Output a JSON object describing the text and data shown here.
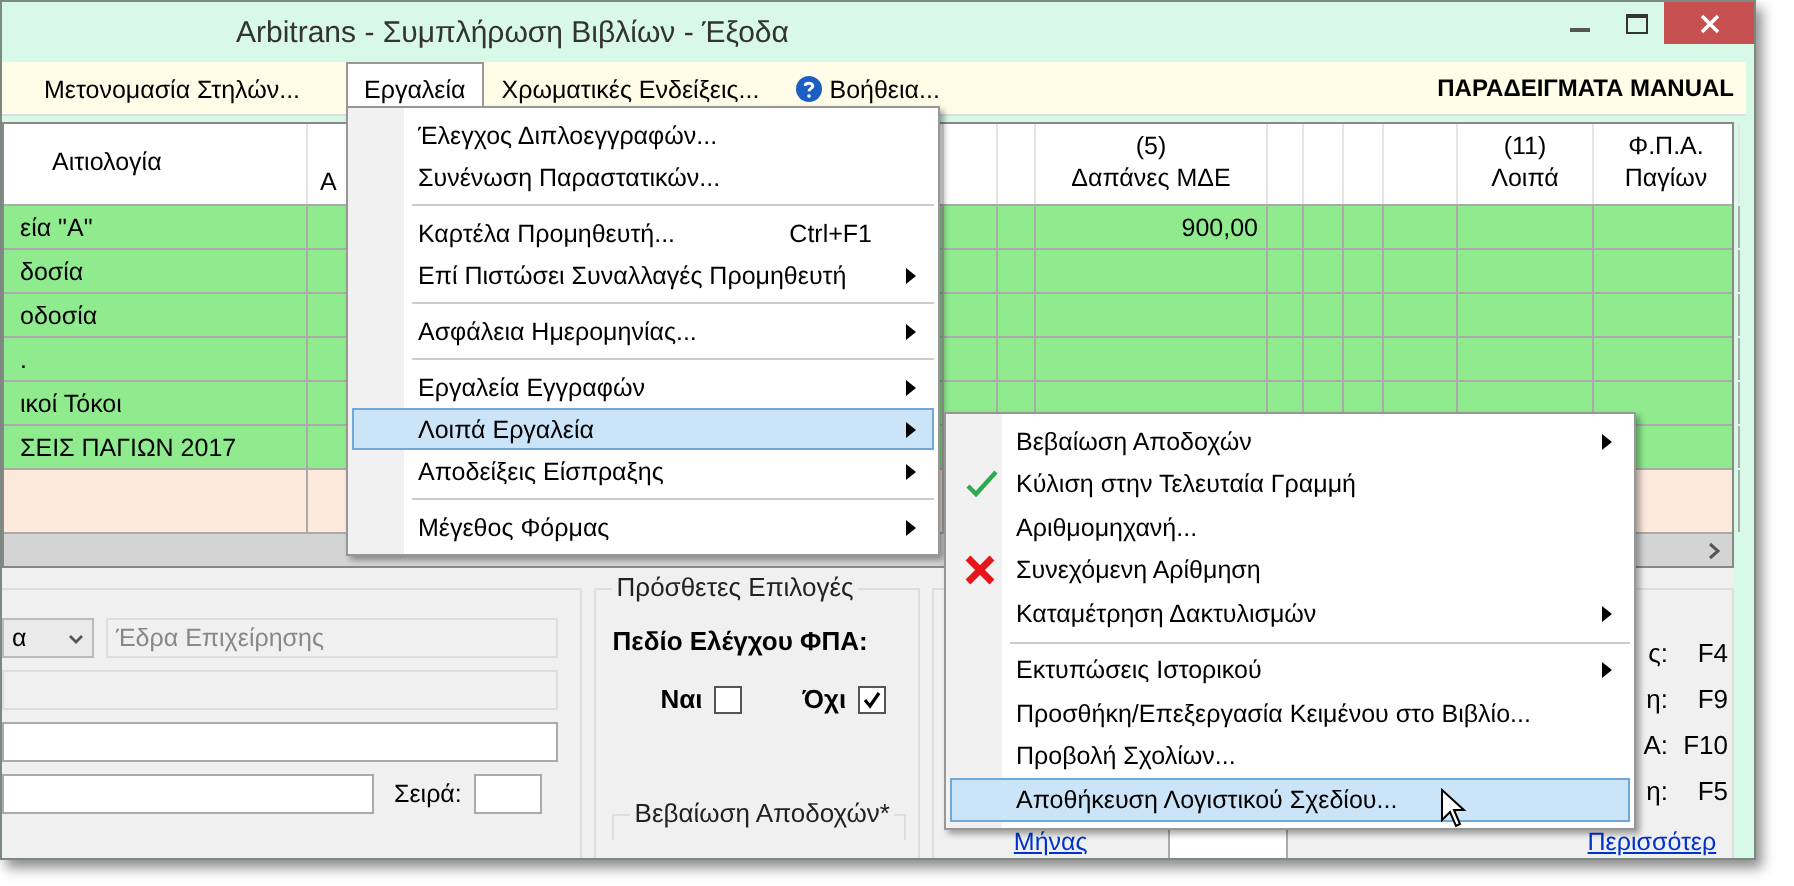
{
  "window": {
    "title": "Arbitrans - Συμπλήρωση Βιβλίων - Έξοδα"
  },
  "menu_bar": {
    "items": [
      {
        "label": "Μετονομασία Στηλών...",
        "kind": "plain",
        "selected": false
      },
      {
        "label": "Εργαλεία",
        "kind": "plain",
        "selected": true
      },
      {
        "label": "Χρωματικές Ενδείξεις...",
        "kind": "plain",
        "selected": false
      },
      {
        "label": "Βοήθεια...",
        "kind": "help",
        "selected": false
      }
    ],
    "company": "ΠΑΡΑΔΕΙΓΜΑΤΑ MANUAL"
  },
  "grid": {
    "headers": [
      {
        "lines": [
          "Αιτιολογία"
        ]
      },
      {
        "lines": [
          "Α"
        ]
      },
      {
        "lines": [
          "(5)",
          "Δαπάνες ΜΔΕ"
        ]
      },
      {
        "lines": [
          "(11)",
          "Λοιπά"
        ]
      },
      {
        "lines": [
          "Φ.Π.Α.",
          "Παγίων"
        ]
      }
    ],
    "rows": [
      {
        "kind": "entry",
        "description": "εία \"Α\"",
        "mde": "900,00"
      },
      {
        "kind": "entry",
        "description": "δοσία"
      },
      {
        "kind": "entry",
        "description": "οδοσία"
      },
      {
        "kind": "entry",
        "description": "."
      },
      {
        "kind": "entry",
        "description": "ικοί Τόκοι"
      },
      {
        "kind": "entry",
        "description": "ΣΕΙΣ ΠΑΓΙΩΝ 2017"
      },
      {
        "kind": "new"
      }
    ]
  },
  "details": {
    "branch_combo": "α",
    "branch_field": "Έδρα Επιχείρησης",
    "series_label": "Σειρά:"
  },
  "extra_options": {
    "title": "Πρόσθετες Επιλογές",
    "vat_check_label": "Πεδίο Ελέγχου ΦΠΑ:",
    "options": [
      {
        "label": "Ναι",
        "checked": false
      },
      {
        "label": "Όχι",
        "checked": true
      }
    ],
    "subgroup_title": "Βεβαίωση Αποδοχών*"
  },
  "shortcuts": [
    {
      "label": "ς:",
      "key": "F4"
    },
    {
      "label": "η:",
      "key": "F9"
    },
    {
      "label": "Α:",
      "key": "F10"
    },
    {
      "label": "η:",
      "key": "F5"
    }
  ],
  "links": {
    "month": "Μήνας",
    "more": "Περισσότερ"
  },
  "tools_menu": {
    "items": [
      {
        "kind": "item",
        "label": "Έλεγχος Διπλοεγγραφών...",
        "submenu": false,
        "selected": false
      },
      {
        "kind": "item",
        "label": "Συνένωση Παραστατικών...",
        "submenu": false,
        "selected": false
      },
      {
        "kind": "separator"
      },
      {
        "kind": "item",
        "label": "Καρτέλα Προμηθευτή...",
        "shortcut": "Ctrl+F1",
        "submenu": false,
        "selected": false
      },
      {
        "kind": "item",
        "label": "Επί Πιστώσει Συναλλαγές Προμηθευτή",
        "submenu": true,
        "selected": false
      },
      {
        "kind": "separator"
      },
      {
        "kind": "item",
        "label": "Ασφάλεια Ημερομηνίας...",
        "submenu": true,
        "selected": false
      },
      {
        "kind": "separator"
      },
      {
        "kind": "item",
        "label": "Εργαλεία Εγγραφών",
        "submenu": true,
        "selected": false
      },
      {
        "kind": "item",
        "label": "Λοιπά Εργαλεία",
        "submenu": true,
        "selected": true
      },
      {
        "kind": "item",
        "label": "Αποδείξεις Είσπραξης",
        "submenu": true,
        "selected": false
      },
      {
        "kind": "separator"
      },
      {
        "kind": "item",
        "label": "Μέγεθος Φόρμας",
        "submenu": true,
        "selected": false
      }
    ]
  },
  "other_tools_menu": {
    "items": [
      {
        "kind": "item",
        "label": "Βεβαίωση Αποδοχών",
        "checked": false,
        "off": false,
        "submenu": true,
        "selected": false
      },
      {
        "kind": "item",
        "label": "Κύλιση στην Τελευταία Γραμμή",
        "checked": true,
        "off": false,
        "submenu": false,
        "selected": false
      },
      {
        "kind": "item",
        "label": "Αριθμομηχανή...",
        "checked": false,
        "off": false,
        "submenu": false,
        "selected": false
      },
      {
        "kind": "item",
        "label": "Συνεχόμενη Αρίθμηση",
        "checked": false,
        "off": true,
        "submenu": false,
        "selected": false
      },
      {
        "kind": "item",
        "label": "Καταμέτρηση Δακτυλισμών",
        "checked": false,
        "off": false,
        "submenu": true,
        "selected": false
      },
      {
        "kind": "separator"
      },
      {
        "kind": "item",
        "label": "Εκτυπώσεις Ιστορικού",
        "checked": false,
        "off": false,
        "submenu": true,
        "selected": false
      },
      {
        "kind": "item",
        "label": "Προσθήκη/Επεξεργασία Κειμένου στο Βιβλίο...",
        "checked": false,
        "off": false,
        "submenu": false,
        "selected": false
      },
      {
        "kind": "item",
        "label": "Προβολή Σχολίων...",
        "checked": false,
        "off": false,
        "submenu": false,
        "selected": false
      },
      {
        "kind": "item",
        "label": "Αποθήκευση Λογιστικού Σχεδίου...",
        "checked": false,
        "off": false,
        "submenu": false,
        "selected": true
      }
    ]
  }
}
